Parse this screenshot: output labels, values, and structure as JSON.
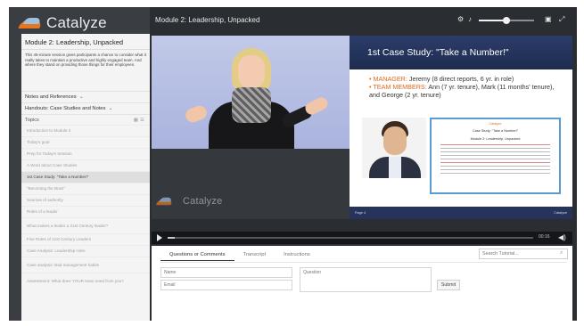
{
  "brand": {
    "name": "Catalyze",
    "accent": "#e7761f",
    "secondary": "#9fc1e0"
  },
  "sidebar": {
    "module_title": "Module 2: Leadership, Unpacked",
    "description": "This 45-minute session gives participants a chance to consider what it really takes to maintain a productive and highly engaged team. And where they stand on providing those things for their employees.",
    "notes_label": "Notes and References",
    "handouts_label": "Handouts: Case Studies and Notes",
    "topics_label": "Topics",
    "topics": [
      {
        "label": "Introduction to Module 2"
      },
      {
        "label": "Today's goal"
      },
      {
        "label": "Prep for Today's Session"
      },
      {
        "label": "A Word about Case Studies"
      },
      {
        "label": "1st Case Study: \"Take a Number!\""
      },
      {
        "label": "\"Becoming the Boss\""
      },
      {
        "label": "Sources of authority"
      },
      {
        "label": "Roles of a leader"
      },
      {
        "label": "What makes a leader a 21st Century leader?"
      },
      {
        "label": "Five Roles of 21st Century Leaders"
      },
      {
        "label": "Case Analysis: Leadership roles"
      },
      {
        "label": "Case analysis: Bad management habits"
      },
      {
        "label": "Assessment: What does YOUR team need from you?"
      }
    ],
    "active_topic_index": 4
  },
  "player": {
    "title": "Module 2: Leadership, Unpacked",
    "volume_level": 0.5,
    "progress": 0.02,
    "time": "00:16"
  },
  "slide": {
    "heading": "1st Case Study:  \"Take a Number!\"",
    "manager_label": "MANAGER:",
    "manager_text": "Jeremy (8 direct reports, 6 yr. in role)",
    "team_label": "TEAM MEMBERS:",
    "team_text": "Ann (7 yr. tenure), Mark (11 months' tenure), and George (2 yr. tenure)",
    "doc_header": "Catalyze",
    "doc_title": "Case Study: \"Take a Number!\"",
    "doc_subtitle": "Module 2: Leadership, Unpacked",
    "footer_left": "Page 4",
    "footer_right": "Catalyze"
  },
  "watermark": "Catalyze",
  "tabs": [
    {
      "label": "Questions or Comments"
    },
    {
      "label": "Transcript"
    },
    {
      "label": "Instructions"
    }
  ],
  "search": {
    "placeholder": "Search Tutorial..."
  },
  "form": {
    "name_placeholder": "Name",
    "email_placeholder": "Email",
    "question_placeholder": "Question",
    "submit_label": "Submit"
  }
}
